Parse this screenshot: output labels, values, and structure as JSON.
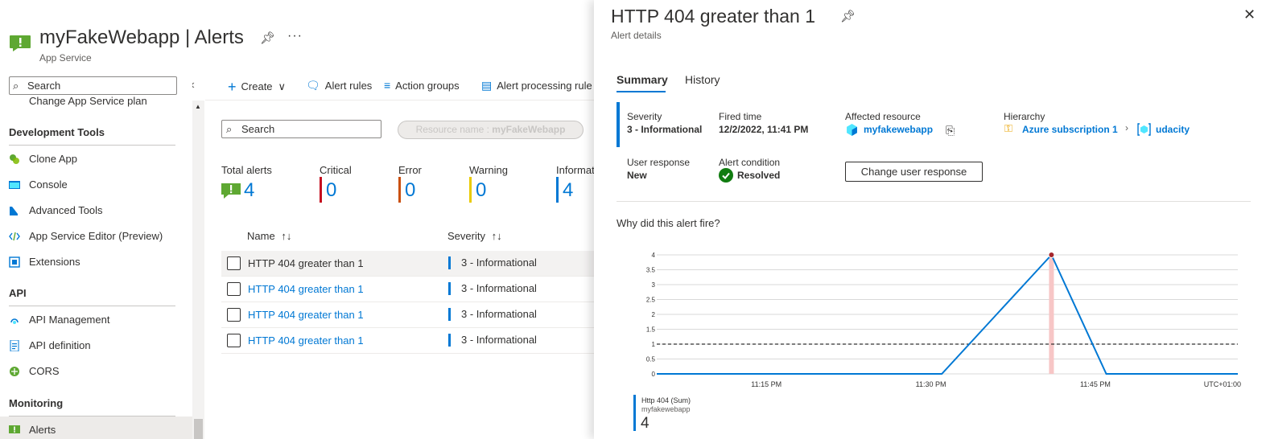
{
  "header": {
    "title": "myFakeWebapp | Alerts",
    "subtitle": "App Service",
    "more": "···"
  },
  "sidebar": {
    "search_placeholder": "Search",
    "cut_item": "Change App Service plan",
    "sections": [
      {
        "title": "Development Tools",
        "items": [
          {
            "label": "Clone App",
            "icon": "clone-app-icon"
          },
          {
            "label": "Console",
            "icon": "console-icon"
          },
          {
            "label": "Advanced Tools",
            "icon": "advanced-tools-icon"
          },
          {
            "label": "App Service Editor (Preview)",
            "icon": "code-editor-icon"
          },
          {
            "label": "Extensions",
            "icon": "extensions-icon"
          }
        ]
      },
      {
        "title": "API",
        "items": [
          {
            "label": "API Management",
            "icon": "api-management-icon"
          },
          {
            "label": "API definition",
            "icon": "api-definition-icon"
          },
          {
            "label": "CORS",
            "icon": "cors-icon"
          }
        ]
      },
      {
        "title": "Monitoring",
        "items": [
          {
            "label": "Alerts",
            "icon": "alerts-icon",
            "active": true
          }
        ]
      }
    ]
  },
  "toolbar": {
    "create": "Create",
    "alert_rules": "Alert rules",
    "action_groups": "Action groups",
    "alert_processing": "Alert processing rule"
  },
  "filters": {
    "search_placeholder": "Search",
    "pill_label": "Resource name : ",
    "pill_value": "myFakeWebapp"
  },
  "summary": [
    {
      "label": "Total alerts",
      "value": "4",
      "color": "#0078d4"
    },
    {
      "label": "Critical",
      "value": "0",
      "color": "#c50f1f"
    },
    {
      "label": "Error",
      "value": "0",
      "color": "#ca5010"
    },
    {
      "label": "Warning",
      "value": "0",
      "color": "#eaca00"
    },
    {
      "label": "Informati",
      "value": "4",
      "color": "#0078d4"
    }
  ],
  "table": {
    "columns": [
      "Name",
      "Severity"
    ],
    "sort_icon": "↑↓",
    "rows": [
      {
        "name": "HTTP 404 greater than 1",
        "severity": "3 - Informational"
      },
      {
        "name": "HTTP 404 greater than 1",
        "severity": "3 - Informational"
      },
      {
        "name": "HTTP 404 greater than 1",
        "severity": "3 - Informational"
      },
      {
        "name": "HTTP 404 greater than 1",
        "severity": "3 - Informational"
      }
    ]
  },
  "panel": {
    "title": "HTTP 404 greater than 1",
    "subtitle": "Alert details",
    "tabs": [
      "Summary",
      "History"
    ],
    "fields": {
      "severity_label": "Severity",
      "severity_value": "3 - Informational",
      "fired_label": "Fired time",
      "fired_value": "12/2/2022, 11:41 PM",
      "resource_label": "Affected resource",
      "resource_value": "myfakewebapp",
      "hierarchy_label": "Hierarchy",
      "hierarchy_sub": "Azure subscription 1",
      "hierarchy_rg": "udacity",
      "user_resp_label": "User response",
      "user_resp_value": "New",
      "condition_label": "Alert condition",
      "condition_value": "Resolved"
    },
    "change_button": "Change user response",
    "why": "Why did this alert fire?",
    "legend_name": "Http 404 (Sum)",
    "legend_resource": "myfakewebapp",
    "legend_value": "4",
    "timezone": "UTC+01:00"
  },
  "chart_data": {
    "type": "line",
    "ylim": [
      0,
      4
    ],
    "yticks": [
      "0",
      "0.5",
      "1",
      "1.5",
      "2",
      "2.5",
      "3",
      "3.5",
      "4"
    ],
    "xticks": [
      "11:15 PM",
      "11:30 PM",
      "11:45 PM"
    ],
    "threshold": 1,
    "series": [
      {
        "name": "Http 404 (Sum)",
        "x": [
          "11:05 PM",
          "11:31 PM",
          "11:36 PM",
          "11:41 PM",
          "11:46 PM",
          "11:58 PM"
        ],
        "values": [
          0,
          0,
          2,
          4,
          0,
          0
        ]
      }
    ],
    "highlight_x": "11:41 PM",
    "colors": {
      "line": "#0078d4",
      "threshold": "#323130",
      "highlight": "#f7c6c6",
      "point": "#a4262c"
    }
  }
}
